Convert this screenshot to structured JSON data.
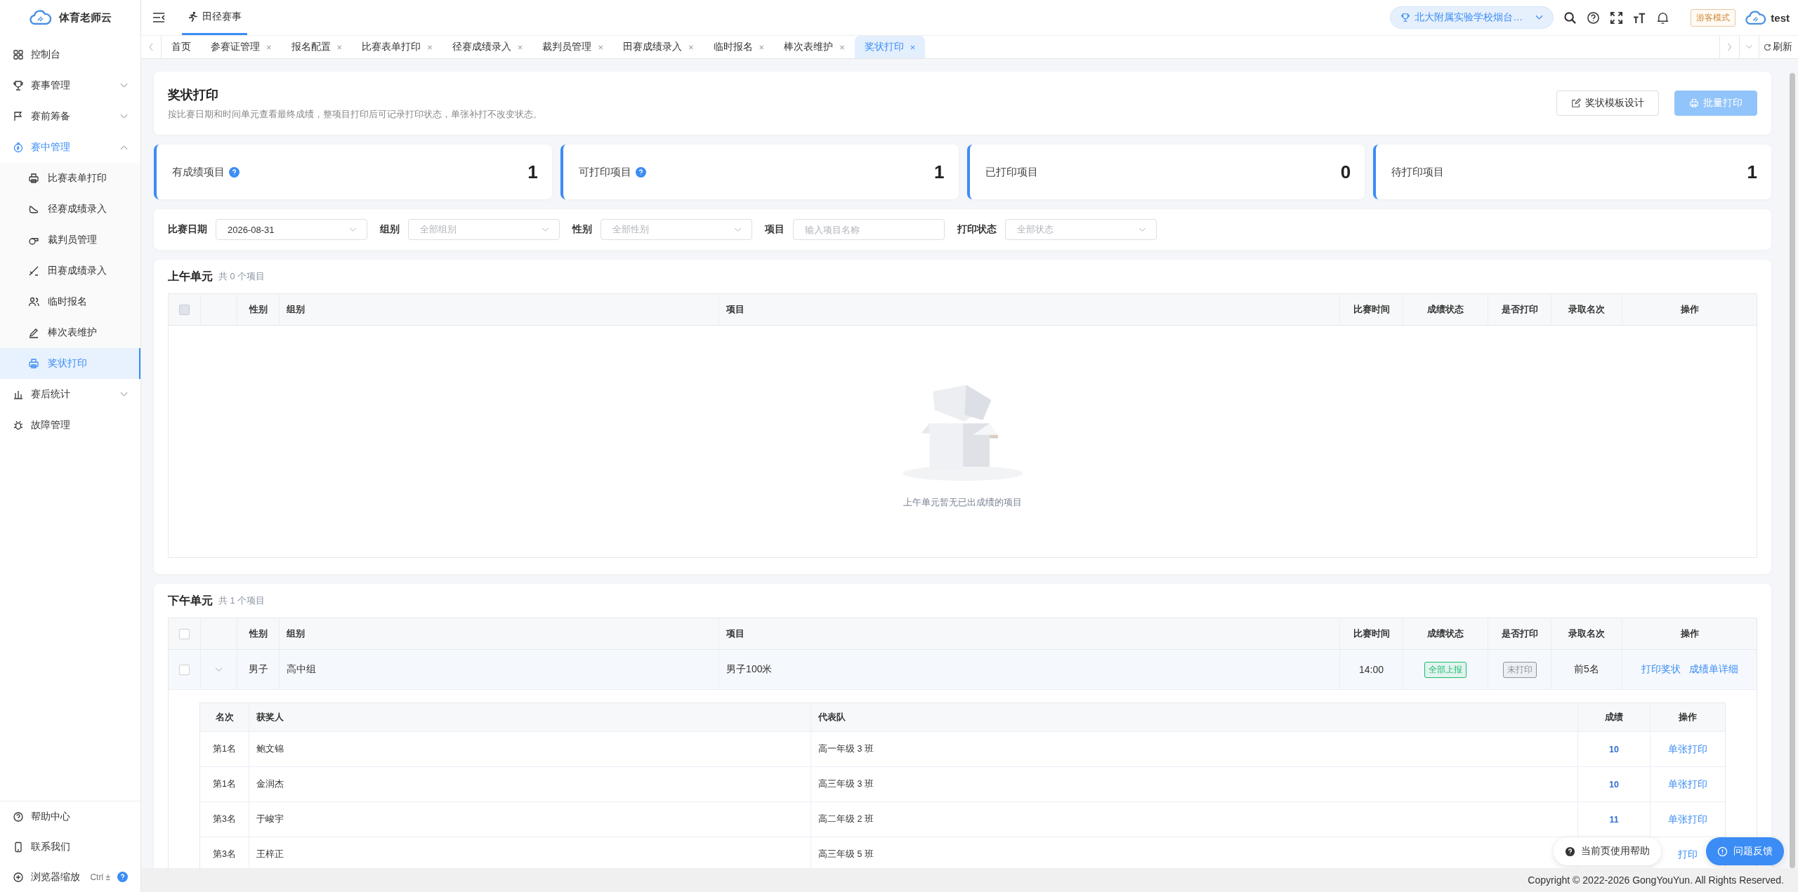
{
  "sidebar": {
    "logo": "体育老师云",
    "items": [
      {
        "label": "控制台",
        "selected": false
      },
      {
        "label": "赛事管理",
        "selected": false,
        "expanded": false
      },
      {
        "label": "赛前筹备",
        "selected": false,
        "expanded": false
      },
      {
        "label": "赛中管理",
        "selected": false,
        "expanded": true,
        "children": [
          {
            "label": "比赛表单打印",
            "selected": false
          },
          {
            "label": "径赛成绩录入",
            "selected": false
          },
          {
            "label": "裁判员管理",
            "selected": false
          },
          {
            "label": "田赛成绩录入",
            "selected": false
          },
          {
            "label": "临时报名",
            "selected": false
          },
          {
            "label": "棒次表维护",
            "selected": false
          },
          {
            "label": "奖状打印",
            "selected": true
          }
        ]
      },
      {
        "label": "赛后统计",
        "selected": false,
        "expanded": false
      },
      {
        "label": "故障管理",
        "selected": false
      }
    ],
    "bottom": [
      {
        "label": "帮助中心"
      },
      {
        "label": "联系我们"
      },
      {
        "label": "浏览器缩放",
        "shortcut": "Ctrl ±"
      }
    ]
  },
  "header": {
    "module_tab": "田径赛事",
    "school": "北大附属实验学校烟台…",
    "mode_badge": "游客模式",
    "user": "test"
  },
  "tabs": [
    {
      "label": "首页",
      "selected": false
    },
    {
      "label": "参赛证管理",
      "close": "×",
      "selected": false
    },
    {
      "label": "报名配置",
      "close": "×",
      "selected": false
    },
    {
      "label": "比赛表单打印",
      "close": "×",
      "selected": false
    },
    {
      "label": "径赛成绩录入",
      "close": "×",
      "selected": false
    },
    {
      "label": "裁判员管理",
      "close": "×",
      "selected": false
    },
    {
      "label": "田赛成绩录入",
      "close": "×",
      "selected": false
    },
    {
      "label": "临时报名",
      "close": "×",
      "selected": false
    },
    {
      "label": "棒次表维护",
      "close": "×",
      "selected": false
    },
    {
      "label": "奖状打印",
      "close": "×",
      "selected": true
    }
  ],
  "refresh": "刷新",
  "page": {
    "title": "奖状打印",
    "subtitle": "按比赛日期和时间单元查看最终成绩，整项目打印后可记录打印状态，单张补打不改变状态。",
    "buttons": [
      {
        "label": "奖状模板设计",
        "kind": "plain"
      },
      {
        "label": "批量打印",
        "kind": "primary",
        "disabled": true
      }
    ]
  },
  "stats": [
    {
      "label": "有成绩项目",
      "help": true,
      "value": "1"
    },
    {
      "label": "可打印项目",
      "help": true,
      "value": "1"
    },
    {
      "label": "已打印项目",
      "help": false,
      "value": "0"
    },
    {
      "label": "待打印项目",
      "help": false,
      "value": "1"
    }
  ],
  "filters": [
    {
      "label": "比赛日期",
      "kind": "select",
      "value": "2026-08-31"
    },
    {
      "label": "组别",
      "kind": "select",
      "placeholder": "全部组别"
    },
    {
      "label": "性别",
      "kind": "select",
      "placeholder": "全部性别"
    },
    {
      "label": "项目",
      "kind": "input",
      "placeholder": "输入项目名称"
    },
    {
      "label": "打印状态",
      "kind": "select",
      "placeholder": "全部状态"
    }
  ],
  "sessions": [
    {
      "title": "上午单元",
      "count": "共 0 个项目",
      "columns": [
        "性别",
        "组别",
        "项目",
        "比赛时间",
        "成绩状态",
        "是否打印",
        "录取名次",
        "操作"
      ],
      "header_checkbox": {
        "checked": false,
        "disabled": true
      },
      "empty_text": "上午单元暂无已出成绩的项目"
    },
    {
      "title": "下午单元",
      "count": "共 1 个项目",
      "columns": [
        "性别",
        "组别",
        "项目",
        "比赛时间",
        "成绩状态",
        "是否打印",
        "录取名次",
        "操作"
      ],
      "header_checkbox": {
        "checked": false,
        "disabled": false
      },
      "rows": [
        {
          "checked": false,
          "expanded": true,
          "gender": "男子",
          "group": "高中组",
          "event": "男子100米",
          "time": "14:00",
          "status": {
            "text": "全部上报",
            "color": "#19be6b"
          },
          "printed": {
            "text": "未打印",
            "color": "#909399"
          },
          "admit": "前5名",
          "actions": [
            "打印奖状",
            "成绩单详细"
          ],
          "detail": {
            "columns": [
              "名次",
              "获奖人",
              "代表队",
              "成绩",
              "操作"
            ],
            "rows": [
              [
                "第1名",
                "鲍文锦",
                "高一年级 3 班",
                "10",
                "单张打印"
              ],
              [
                "第1名",
                "金润杰",
                "高三年级 3 班",
                "10",
                "单张打印"
              ],
              [
                "第3名",
                "于峻宇",
                "高二年级 2 班",
                "11",
                "单张打印"
              ],
              [
                "第3名",
                "王梓正",
                "高三年级 5 班",
                "",
                "打印"
              ]
            ]
          }
        }
      ]
    }
  ],
  "float_buttons": [
    "当前页使用帮助",
    "问题反馈"
  ],
  "footer": "Copyright © 2022-2026 GongYouYun. All Rights Reserved."
}
